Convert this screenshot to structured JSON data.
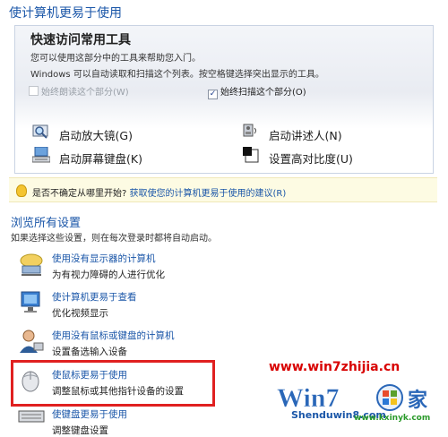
{
  "header": {
    "title": "使计算机更易于使用"
  },
  "quick_access": {
    "heading": "快速访问常用工具",
    "description": "您可以使用这部分中的工具来帮助您入门。",
    "description2": "Windows 可以自动读取和扫描这个列表。按空格键选择突出显示的工具。",
    "checkbox_read": {
      "label": "始终朗读这个部分(W)",
      "checked": false
    },
    "checkbox_scan": {
      "label": "始终扫描这个部分(O)",
      "checked": true
    },
    "tools": [
      {
        "label": "启动放大镜(G)",
        "icon": "magnifier-icon"
      },
      {
        "label": "启动讲述人(N)",
        "icon": "narrator-icon"
      },
      {
        "label": "启动屏幕键盘(K)",
        "icon": "onscreen-keyboard-icon"
      },
      {
        "label": "设置高对比度(U)",
        "icon": "high-contrast-icon"
      }
    ]
  },
  "tip": {
    "prefix": "是否不确定从哪里开始?",
    "link": "获取使您的计算机更易于使用的建议(R)"
  },
  "browse": {
    "heading": "浏览所有设置",
    "description": "如果选择这些设置，则在每次登录时都将自动启动。",
    "settings": [
      {
        "title": "使用没有显示器的计算机",
        "desc": "为有视力障碍的人进行优化",
        "icon": "no-display-icon"
      },
      {
        "title": "使计算机更易于查看",
        "desc": "优化视频显示",
        "icon": "monitor-icon"
      },
      {
        "title": "使用没有鼠标或键盘的计算机",
        "desc": "设置备选输入设备",
        "icon": "user-input-icon"
      },
      {
        "title": "使鼠标更易于使用",
        "desc": "调整鼠标或其他指针设备的设置",
        "icon": "mouse-icon"
      },
      {
        "title": "使键盘更易于使用",
        "desc": "调整键盘设置",
        "icon": "keyboard-icon"
      }
    ]
  },
  "watermark": {
    "url": "www.win7zhijia.cn",
    "logo_text": "Win7之家",
    "site2": "Shenduwin8.com",
    "site3": "www.kxinyk.com"
  },
  "colors": {
    "link": "#1a56a8",
    "highlight": "#e02020",
    "tip_bg": "#fdfbe3"
  }
}
